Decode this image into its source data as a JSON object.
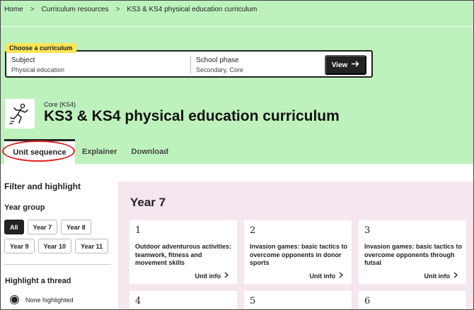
{
  "breadcrumb": [
    "Home",
    "Curriculum resources",
    "KS3 & KS4 physical education curriculum"
  ],
  "chooser": {
    "tag": "Choose a curriculum",
    "subject_label": "Subject",
    "subject_value": "Physical education",
    "phase_label": "School phase",
    "phase_value": "Secondary, Core",
    "view_label": "View",
    "view_icon": "arrow-right-icon"
  },
  "header": {
    "icon": "pe-running-icon",
    "core_label": "Core (KS4)",
    "title": "KS3 & KS4 physical education curriculum"
  },
  "tabs": [
    {
      "label": "Unit sequence",
      "active": true
    },
    {
      "label": "Explainer",
      "active": false
    },
    {
      "label": "Download",
      "active": false
    }
  ],
  "sidebar": {
    "filter_title": "Filter and highlight",
    "year_group_title": "Year group",
    "year_groups": [
      {
        "label": "All",
        "selected": true
      },
      {
        "label": "Year 7",
        "selected": false
      },
      {
        "label": "Year 8",
        "selected": false
      },
      {
        "label": "Year 9",
        "selected": false
      },
      {
        "label": "Year 10",
        "selected": false
      },
      {
        "label": "Year 11",
        "selected": false
      }
    ],
    "thread_title": "Highlight a thread",
    "thread_option": "None highlighted"
  },
  "main": {
    "year_heading": "Year 7",
    "unit_info_label": "Unit info",
    "cards": [
      {
        "num": "1",
        "title": "Outdoor adventurous activities: teamwork, fitness and movement skills"
      },
      {
        "num": "2",
        "title": "Invasion games: basic tactics to overcome opponents in donor sports"
      },
      {
        "num": "3",
        "title": "Invasion games: basic tactics to overcome opponents through futsal"
      },
      {
        "num": "4",
        "title": ""
      },
      {
        "num": "5",
        "title": ""
      },
      {
        "num": "6",
        "title": ""
      }
    ]
  },
  "colors": {
    "hero_bg": "#bef2bd",
    "main_bg": "#f5e6ef",
    "tag_yellow": "#ffe555",
    "button_dark": "#222222",
    "annotation_red": "#e02020"
  }
}
